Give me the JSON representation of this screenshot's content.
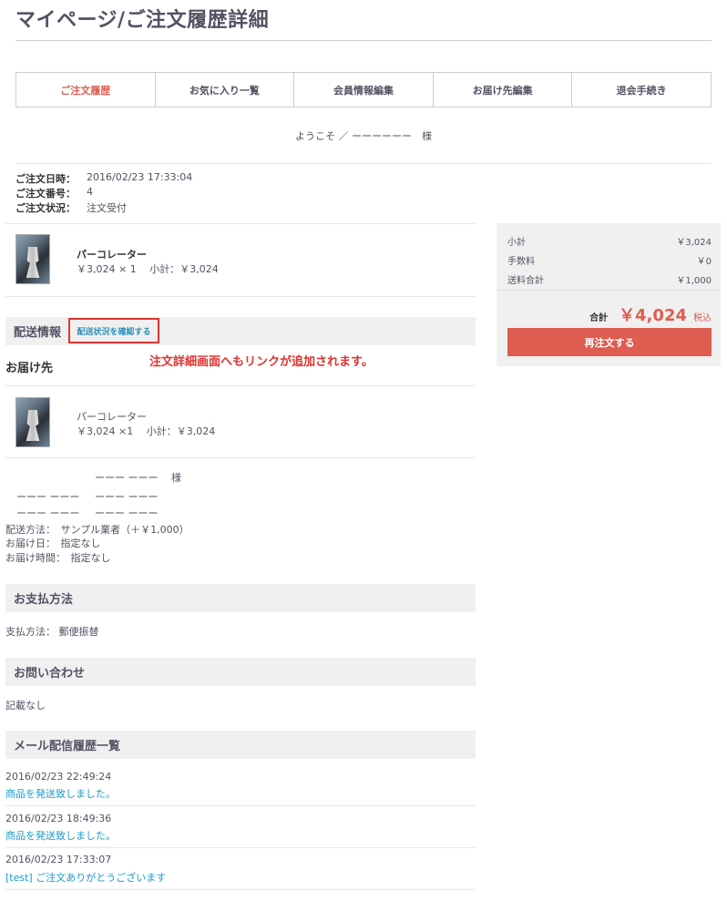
{
  "page": {
    "title": "マイページ/ご注文履歴詳細"
  },
  "tabs": [
    {
      "label": "ご注文履歴",
      "active": true
    },
    {
      "label": "お気に入り一覧"
    },
    {
      "label": "会員情報編集"
    },
    {
      "label": "お届け先編集"
    },
    {
      "label": "退会手続き"
    }
  ],
  "welcome": "ようこそ ／ ーーーーーー　様",
  "order": {
    "date_label": "ご注文日時：",
    "date": "2016/02/23 17:33:04",
    "number_label": "ご注文番号：",
    "number": "4",
    "status_label": "ご注文状況：",
    "status": "注文受付"
  },
  "item": {
    "name": "パーコレーター",
    "price_line": "￥3,024 × 1　 小計：￥3,024"
  },
  "summary": {
    "subtotal_label": "小計",
    "subtotal": "￥3,024",
    "fee_label": "手数料",
    "fee": "￥0",
    "shipping_label": "送料合計",
    "shipping": "￥1,000",
    "total_label": "合計",
    "total": "￥4,024",
    "tax_label": "税込",
    "reorder_label": "再注文する"
  },
  "delivery": {
    "heading": "配送情報",
    "track_link": "配送状況を確認する",
    "annotation": "注文詳細画面へもリンクが追加されます。",
    "dest_heading": "お届け先",
    "item_name": "パーコレーター",
    "item_price_line": "￥3,024 ×1　 小計：￥3,024",
    "name_line": "ーーー ーーー　 様",
    "addr1_a": "ーーー ーーー",
    "addr1_b": "ーーー ーーー",
    "addr2_a": "ーーー ーーー",
    "addr2_b": "ーーー ーーー",
    "method": "配送方法：　サンプル業者（＋￥1,000）",
    "date": "お届け日：　指定なし",
    "time": "お届け時間：　指定なし"
  },
  "payment": {
    "heading": "お支払方法",
    "text": "支払方法：  郵便振替"
  },
  "inquiry": {
    "heading": "お問い合わせ",
    "text": "記載なし"
  },
  "mail": {
    "heading": "メール配信履歴一覧",
    "items": [
      {
        "date": "2016/02/23 22:49:24",
        "subject": "商品を発送致しました。"
      },
      {
        "date": "2016/02/23 18:49:36",
        "subject": "商品を発送致しました。"
      },
      {
        "date": "2016/02/23 17:33:07",
        "subject": "[test] ご注文ありがとうございます"
      }
    ]
  },
  "colors": {
    "accent": "#de5d50",
    "link": "#1a9bcc",
    "annotation": "#e0322f"
  }
}
